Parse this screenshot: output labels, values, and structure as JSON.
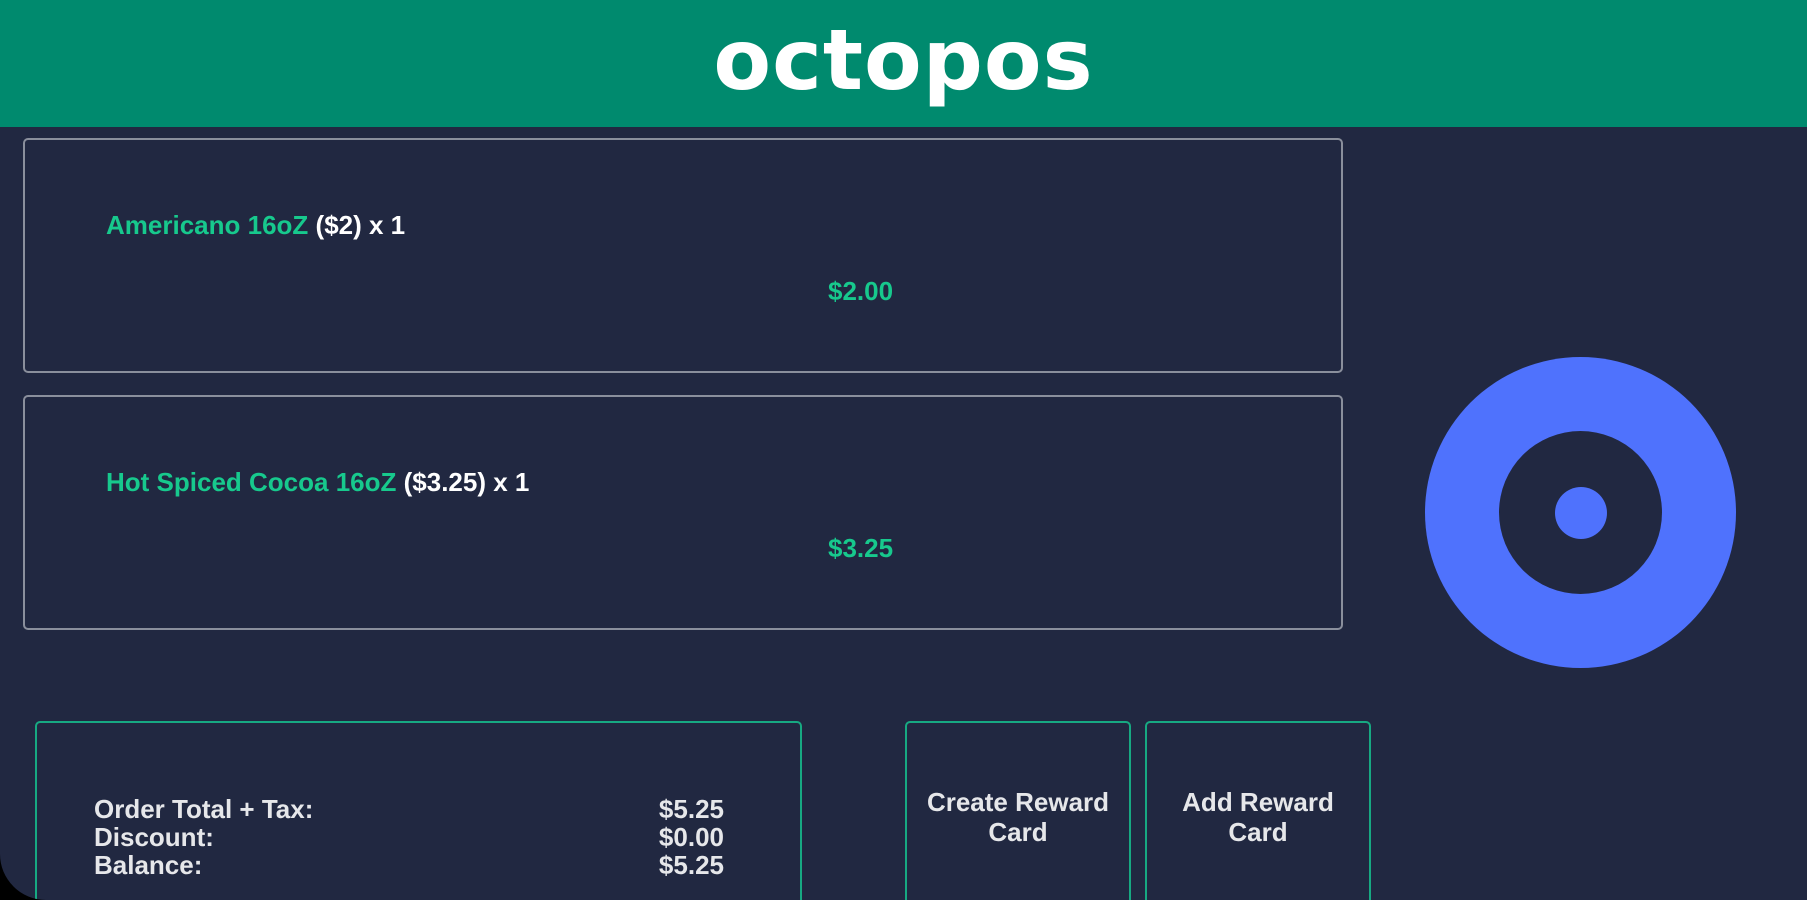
{
  "header": {
    "logo_text": "octopos",
    "color": "#008a6e"
  },
  "items": [
    {
      "name": "Americano 16oZ",
      "detail": "($2) x 1",
      "price": "$2.00"
    },
    {
      "name": "Hot Spiced Cocoa 16oZ",
      "detail": "($3.25) x 1",
      "price": "$3.25"
    }
  ],
  "totals": {
    "order_total_label": "Order Total + Tax:",
    "order_total_value": "$5.25",
    "discount_label": "Discount:",
    "discount_value": "$0.00",
    "balance_label": "Balance:",
    "balance_value": "$5.25"
  },
  "buttons": {
    "create_reward_card": "Create Reward Card",
    "add_reward_card": "Add Reward Card"
  },
  "icons": {
    "scan_button": "target-ring-icon"
  },
  "colors": {
    "background": "#212841",
    "accent_green": "#17c98d",
    "ring_blue": "#4f72fd"
  }
}
